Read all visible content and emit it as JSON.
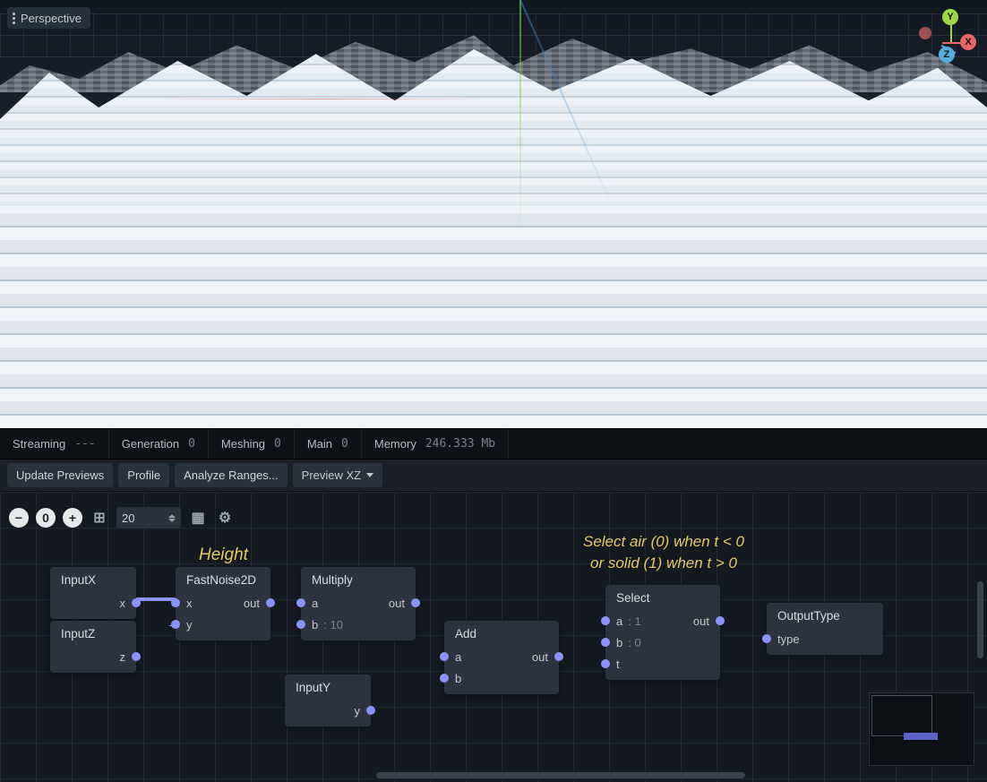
{
  "viewport": {
    "view_mode": "Perspective",
    "gizmo": {
      "x": "X",
      "y": "Y",
      "z": "Z"
    }
  },
  "status": {
    "streaming": {
      "label": "Streaming",
      "value": "---"
    },
    "generation": {
      "label": "Generation",
      "value": "0"
    },
    "meshing": {
      "label": "Meshing",
      "value": "0"
    },
    "main": {
      "label": "Main",
      "value": "0"
    },
    "memory": {
      "label": "Memory",
      "value": "246.333 Mb"
    }
  },
  "toolbar": {
    "update_previews": "Update Previews",
    "profile": "Profile",
    "analyze_ranges": "Analyze Ranges...",
    "preview_mode": "Preview XZ"
  },
  "graph_iconbar": {
    "zoom_out": "−",
    "zoom_reset": "0",
    "zoom_in": "+",
    "snap_icon": "⊞",
    "grid_value": "20",
    "layers_icon": "▦",
    "settings_icon": "⚙"
  },
  "annotations": {
    "height": "Height",
    "select_rule_l1": "Select air (0) when t < 0",
    "select_rule_l2": "or solid (1) when t > 0"
  },
  "nodes": {
    "inputx": {
      "title": "InputX",
      "out": "x"
    },
    "inputz": {
      "title": "InputZ",
      "out": "z"
    },
    "inputy": {
      "title": "InputY",
      "out": "y"
    },
    "fastnoise": {
      "title": "FastNoise2D",
      "in_x": "x",
      "in_y": "y",
      "out": "out"
    },
    "multiply": {
      "title": "Multiply",
      "a": "a",
      "b": "b",
      "b_val": ": 10",
      "out": "out"
    },
    "add": {
      "title": "Add",
      "a": "a",
      "b": "b",
      "out": "out"
    },
    "select": {
      "title": "Select",
      "a": "a",
      "a_val": ": 1",
      "b": "b",
      "b_val": ": 0",
      "t": "t",
      "out": "out"
    },
    "output": {
      "title": "OutputType",
      "in": "type"
    }
  }
}
